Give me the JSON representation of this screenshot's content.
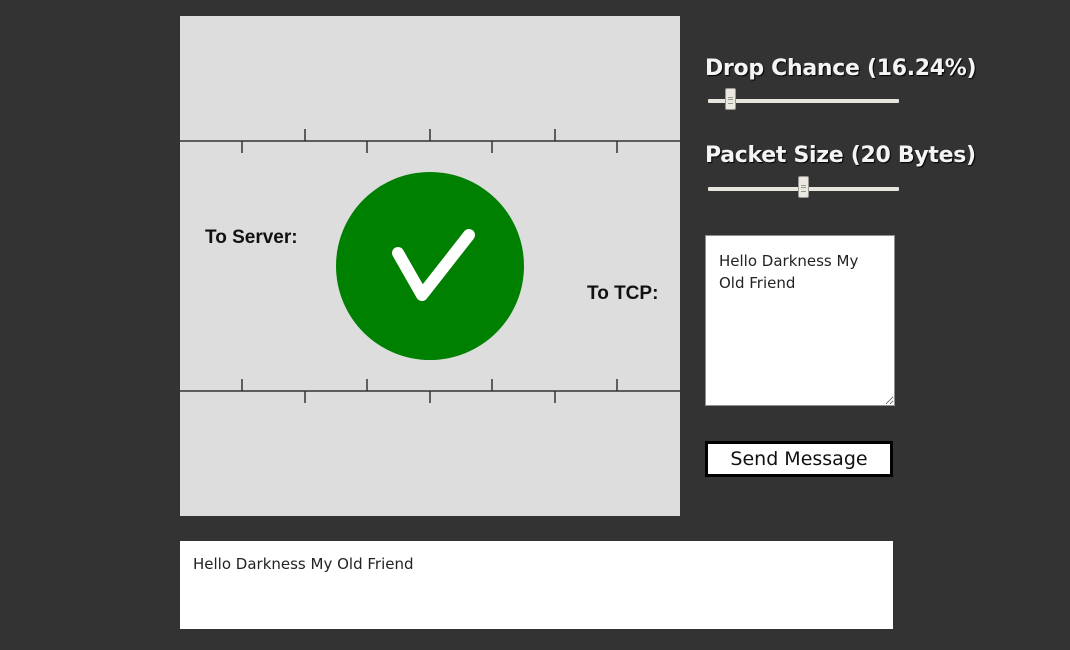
{
  "simulation": {
    "to_server_label": "To Server:",
    "to_tcp_label": "To TCP:",
    "status_icon": "checkmark-icon",
    "status_color": "#008000",
    "background_color": "#dddddd"
  },
  "controls": {
    "drop_chance": {
      "title": "Drop Chance (16.24%)",
      "value_fraction": 0.0924
    },
    "packet_size": {
      "title": "Packet Size (20 Bytes)",
      "value_fraction": 0.5
    }
  },
  "message_input": {
    "value": "Hello Darkness My Old Friend"
  },
  "send_button": {
    "label": "Send Message"
  },
  "output": {
    "text": "Hello Darkness My Old Friend"
  }
}
